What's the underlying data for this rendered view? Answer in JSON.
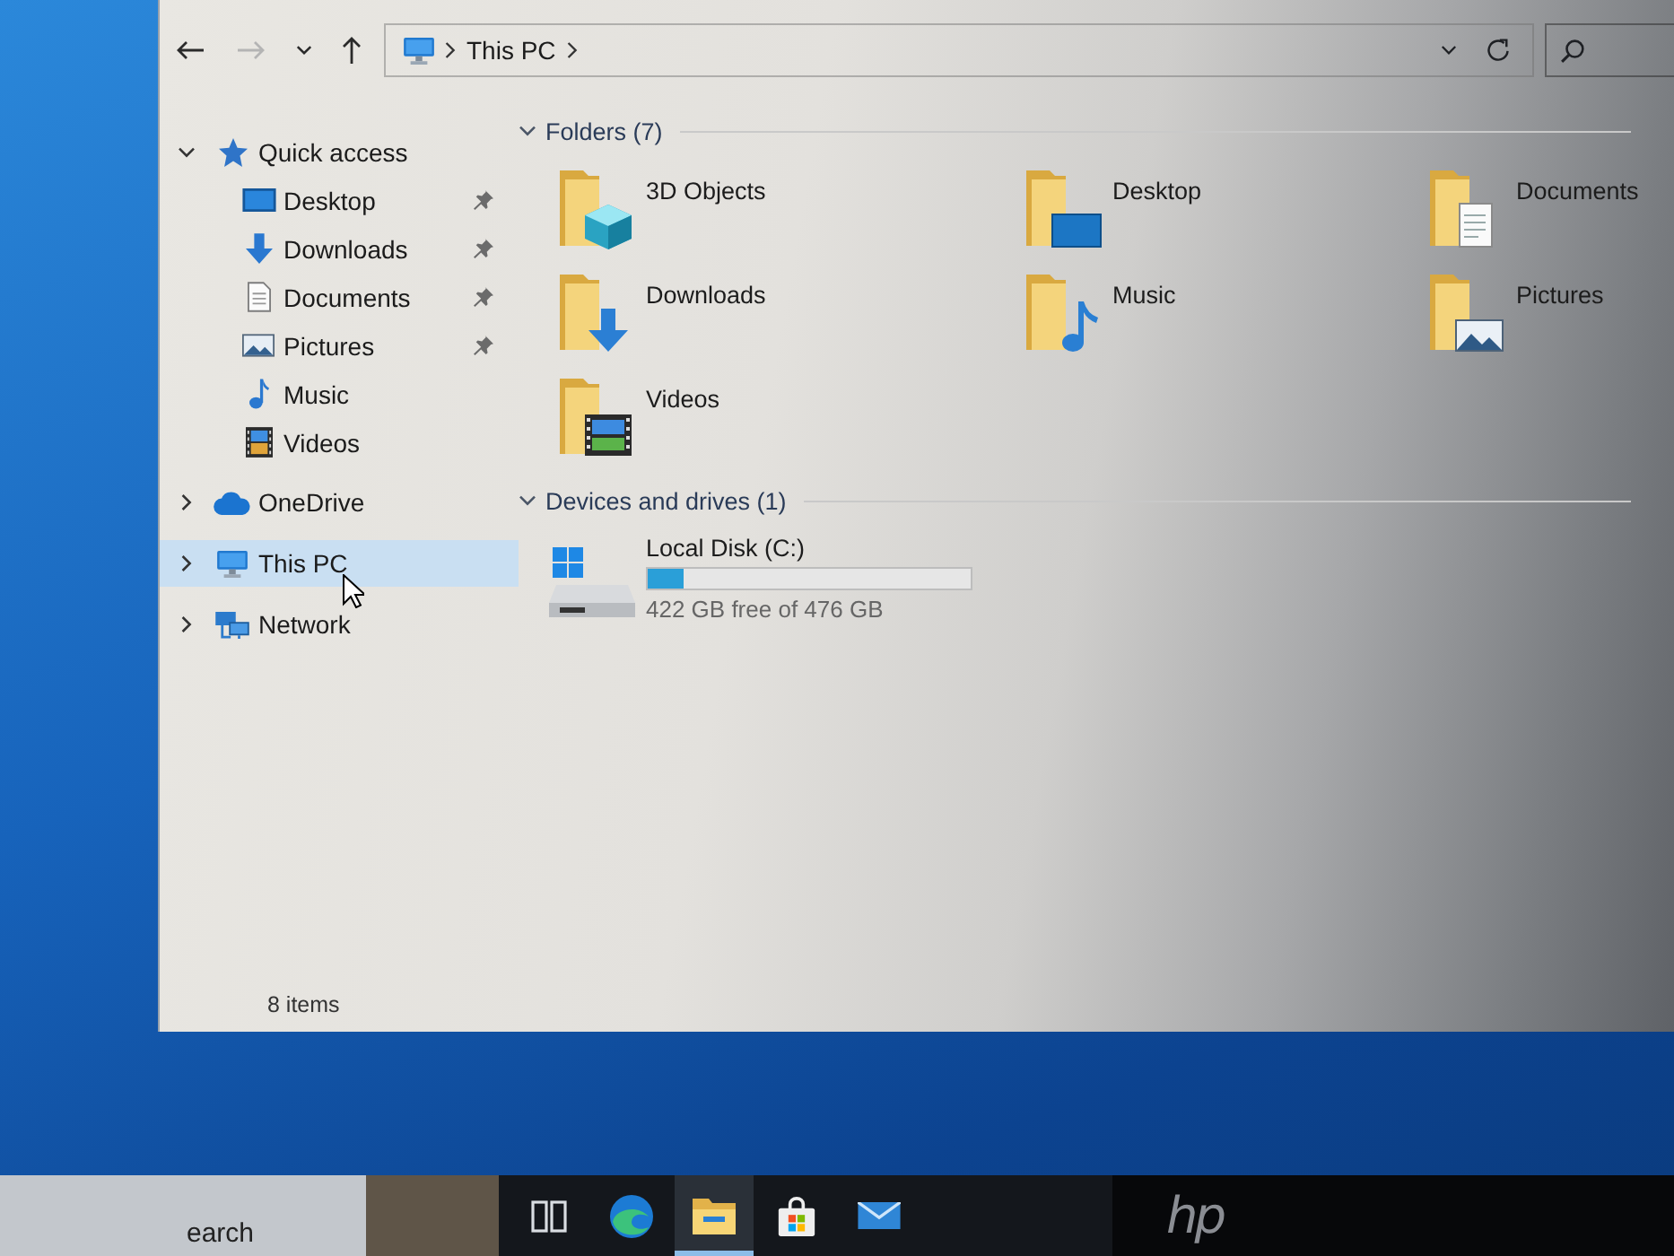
{
  "window": {
    "toolbar": {
      "nav_buttons": [
        {
          "kind": "back",
          "disabled": false
        },
        {
          "kind": "forward",
          "disabled": true
        },
        {
          "kind": "recent",
          "disabled": false
        },
        {
          "kind": "up",
          "disabled": false
        }
      ],
      "address_bar": {
        "path": [
          "This PC"
        ]
      }
    },
    "nav_pane": {
      "items": [
        {
          "kind": "star",
          "label": "Quick access",
          "expanded": true,
          "selected": false,
          "children": [
            {
              "kind": "desktop",
              "label": "Desktop",
              "pinned": true,
              "selected": false
            },
            {
              "kind": "downloads",
              "label": "Downloads",
              "pinned": true,
              "selected": false
            },
            {
              "kind": "documents",
              "label": "Documents",
              "pinned": true,
              "selected": false
            },
            {
              "kind": "pictures",
              "label": "Pictures",
              "pinned": true,
              "selected": false
            },
            {
              "kind": "music",
              "label": "Music",
              "pinned": false,
              "selected": false
            },
            {
              "kind": "videos",
              "label": "Videos",
              "pinned": false,
              "selected": false
            }
          ]
        },
        {
          "kind": "onedrive",
          "label": "OneDrive",
          "expanded": false,
          "selected": false
        },
        {
          "kind": "pc",
          "label": "This PC",
          "expanded": false,
          "selected": true
        },
        {
          "kind": "network",
          "label": "Network",
          "expanded": false,
          "selected": false
        }
      ]
    },
    "content": {
      "sections": [
        {
          "title": "Folders (7)",
          "expanded": true,
          "items": [
            {
              "kind": "objects",
              "label": "3D Objects"
            },
            {
              "kind": "desktop",
              "label": "Desktop"
            },
            {
              "kind": "documents",
              "label": "Documents"
            },
            {
              "kind": "downloads",
              "label": "Downloads"
            },
            {
              "kind": "music",
              "label": "Music"
            },
            {
              "kind": "pictures",
              "label": "Pictures"
            },
            {
              "kind": "videos",
              "label": "Videos"
            }
          ]
        },
        {
          "title": "Devices and drives (1)",
          "expanded": true,
          "items": [
            {
              "kind": "disk",
              "label": "Local Disk (C:)",
              "level": 0.11,
              "space": "422 GB free of 476 GB"
            }
          ]
        }
      ]
    },
    "status_bar": {
      "item_count": "8 items"
    }
  },
  "taskbar": {
    "search": {
      "placeholder": "earch"
    },
    "apps": [
      {
        "kind": "taskview",
        "active": false
      },
      {
        "kind": "browser",
        "active": false
      },
      {
        "kind": "files",
        "active": true
      },
      {
        "kind": "store",
        "active": false
      },
      {
        "kind": "mail",
        "active": false
      }
    ]
  },
  "bezel": {
    "logo": "hp"
  }
}
